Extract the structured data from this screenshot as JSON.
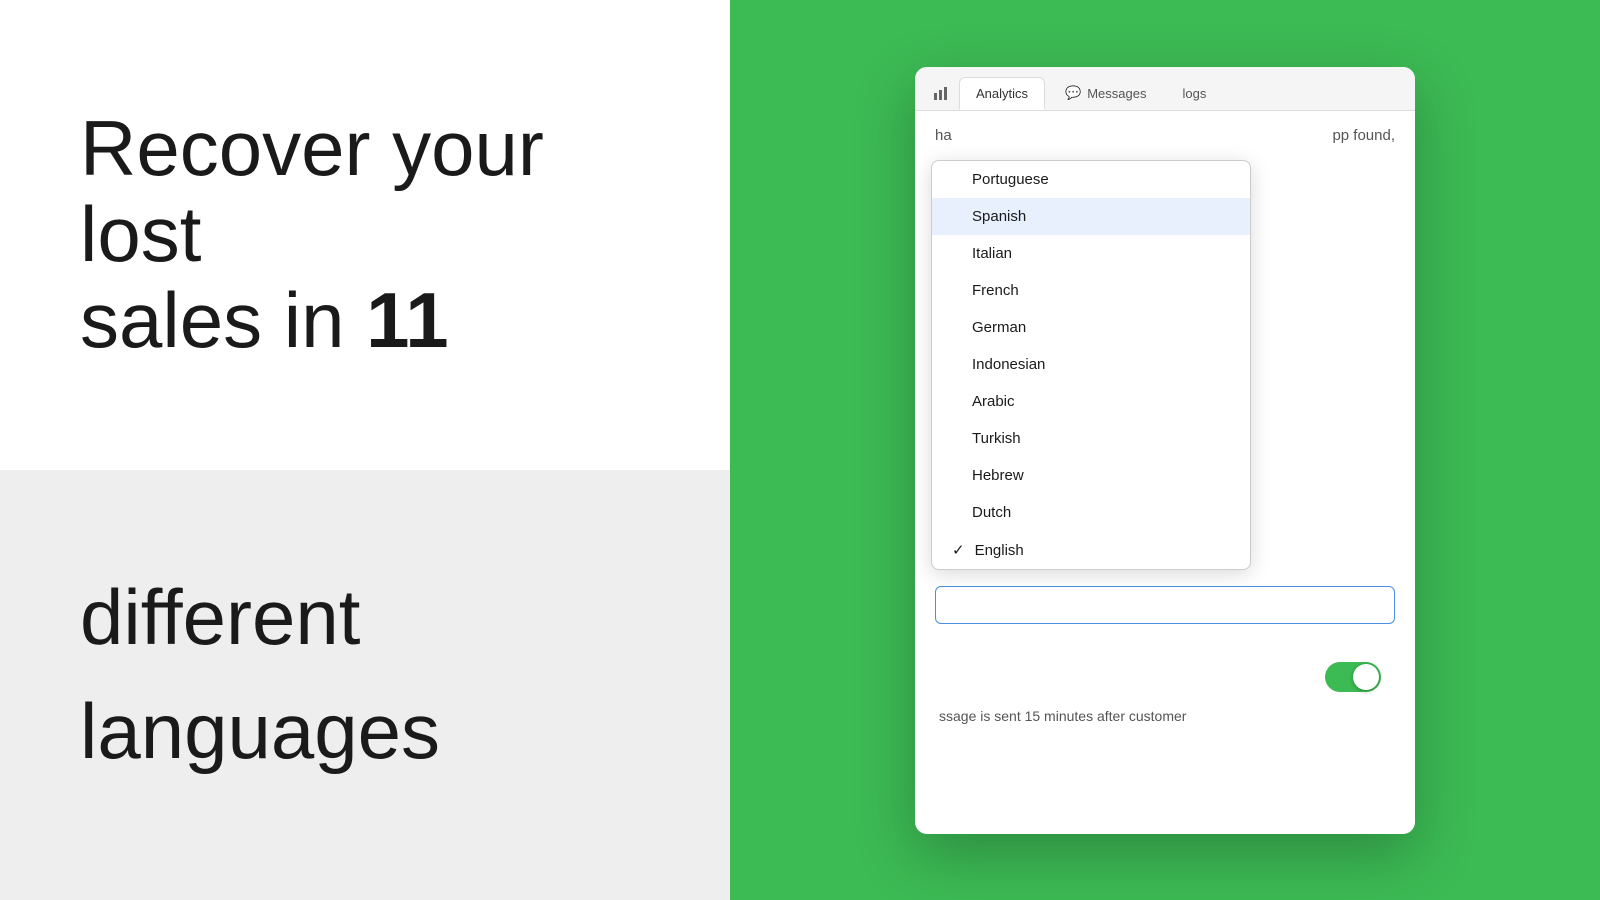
{
  "left": {
    "hero_line1": "Recover your lost",
    "hero_line2": "sales in ",
    "hero_number": "11",
    "bottom_line1": "different",
    "bottom_line2": "languages"
  },
  "app": {
    "tab_analytics_label": "Analytics",
    "tab_messages_label": "Messages",
    "tab_logs_label": "logs",
    "tab_analytics_icon": "📊",
    "tab_messages_icon": "💬",
    "partial_left_text": "ha",
    "partial_right_text": "pp found,",
    "dropdown": {
      "items": [
        {
          "label": "Portuguese",
          "selected": false,
          "highlighted": false
        },
        {
          "label": "Spanish",
          "selected": false,
          "highlighted": true
        },
        {
          "label": "Italian",
          "selected": false,
          "highlighted": false
        },
        {
          "label": "French",
          "selected": false,
          "highlighted": false
        },
        {
          "label": "German",
          "selected": false,
          "highlighted": false
        },
        {
          "label": "Indonesian",
          "selected": false,
          "highlighted": false
        },
        {
          "label": "Arabic",
          "selected": false,
          "highlighted": false
        },
        {
          "label": "Turkish",
          "selected": false,
          "highlighted": false
        },
        {
          "label": "Hebrew",
          "selected": false,
          "highlighted": false
        },
        {
          "label": "Dutch",
          "selected": false,
          "highlighted": false
        },
        {
          "label": "English",
          "selected": true,
          "highlighted": false
        }
      ]
    },
    "toggle_on": true,
    "toggle_label": "ssage is sent 15 minutes after customer"
  },
  "colors": {
    "green": "#3cba54",
    "toggle_green": "#3cba54"
  }
}
